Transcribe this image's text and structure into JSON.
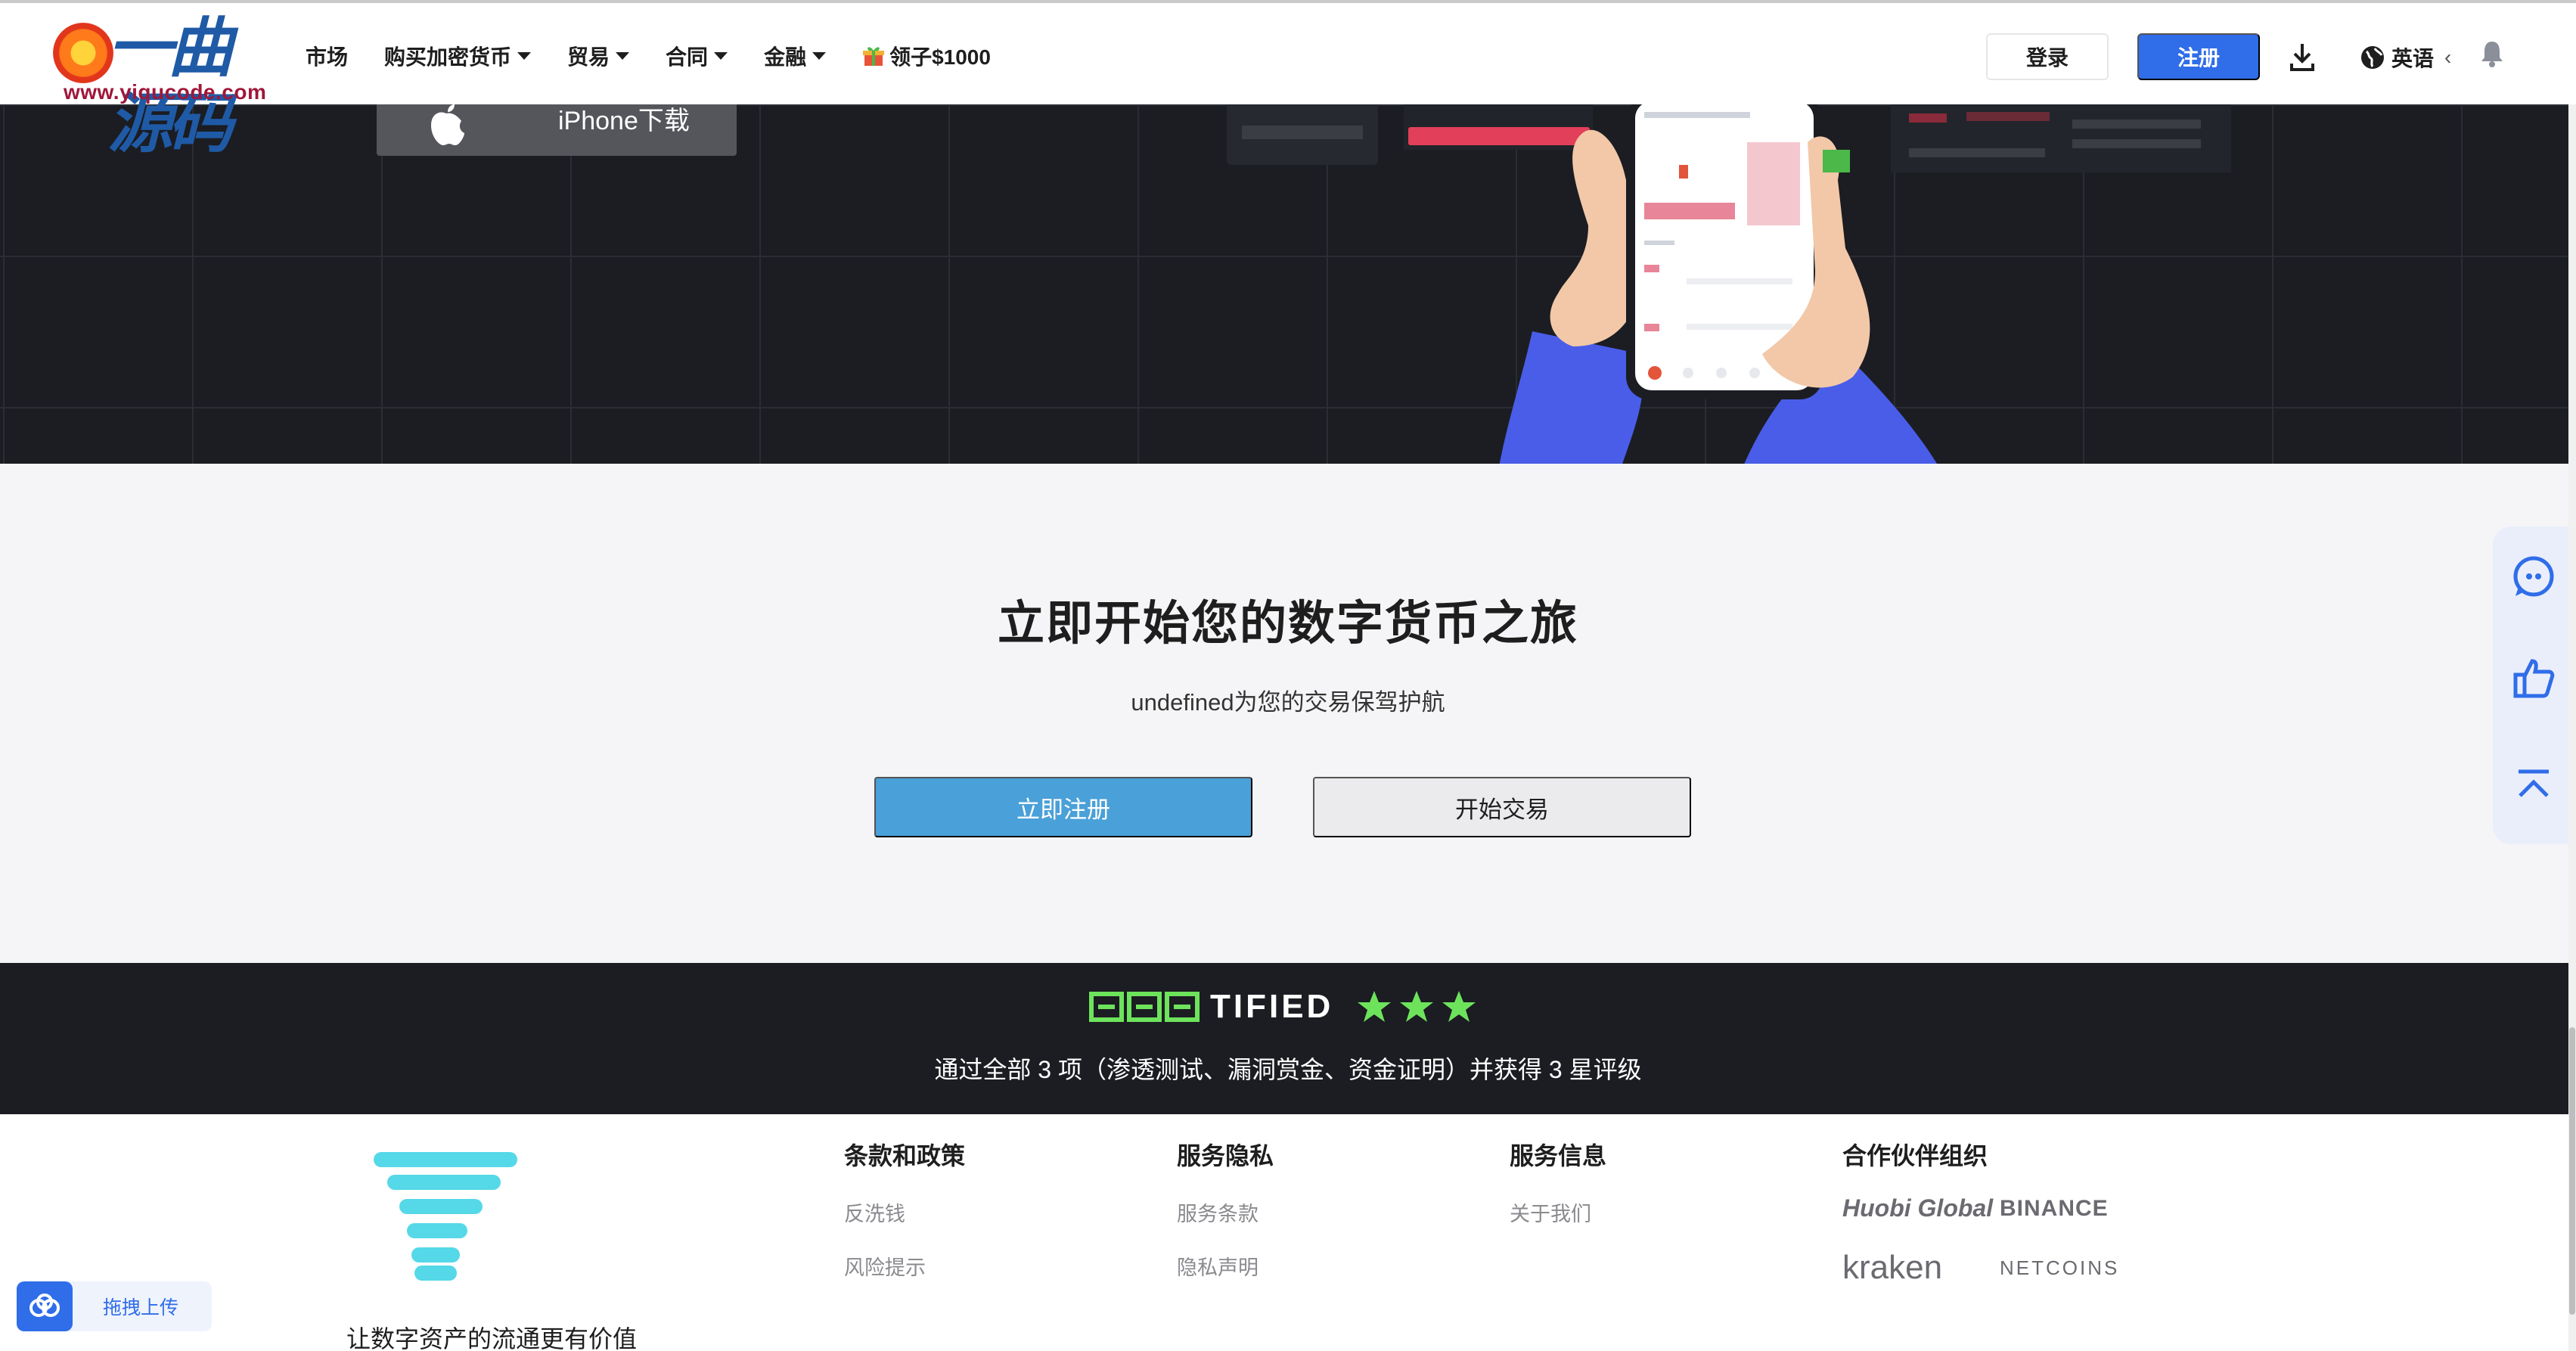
{
  "header": {
    "logo_text": "一曲源码",
    "logo_url": "www.yiqucode.com",
    "nav": [
      {
        "label": "市场",
        "dropdown": false
      },
      {
        "label": "购买加密货币",
        "dropdown": true
      },
      {
        "label": "贸易",
        "dropdown": true
      },
      {
        "label": "合同",
        "dropdown": true
      },
      {
        "label": "金融",
        "dropdown": true
      },
      {
        "label": "领子$1000",
        "dropdown": false,
        "icon": "gift-icon"
      }
    ],
    "login_label": "登录",
    "register_label": "注册",
    "language_label": "英语",
    "language_caret": "‹"
  },
  "hero": {
    "iphone_button_label": "iPhone下载"
  },
  "cta": {
    "title": "立即开始您的数字货币之旅",
    "subtitle": "undefined为您的交易保驾护航",
    "register_button": "立即注册",
    "trade_button": "开始交易"
  },
  "certified": {
    "logo_text": "TIFIED",
    "stars": 3,
    "description": "通过全部 3 项（渗透测试、漏洞赏金、资金证明）并获得 3 星评级"
  },
  "footer": {
    "slogan": "让数字资产的流通更有价值",
    "columns": [
      {
        "title": "条款和政策",
        "links": [
          "反洗钱",
          "风险提示"
        ]
      },
      {
        "title": "服务隐私",
        "links": [
          "服务条款",
          "隐私声明"
        ]
      },
      {
        "title": "服务信息",
        "links": [
          "关于我们"
        ]
      }
    ],
    "partners_title": "合作伙伴组织",
    "partners": [
      "Huobi Global",
      "BINANCE",
      "kraken",
      "NETCOINS"
    ]
  },
  "widgets": {
    "upload_label": "拖拽上传"
  },
  "colors": {
    "primary": "#2f6de9",
    "cta_blue": "#4aa0d8",
    "dark_bg": "#1b1d22",
    "cert_green": "#6de35c",
    "logo_cyan": "#55d8e8"
  }
}
